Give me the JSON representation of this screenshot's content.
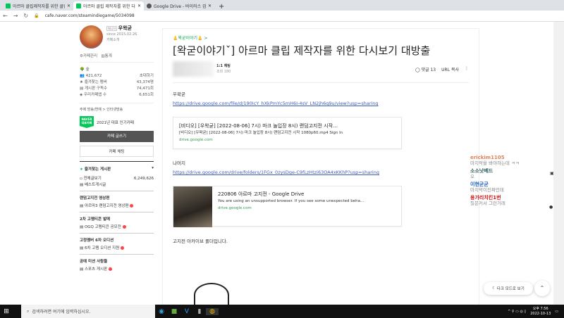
{
  "browser": {
    "tabs": [
      {
        "title": "아르마 클립제작자를 위한 클립영상",
        "active": false
      },
      {
        "title": "아르마 클립 제작자를 위한 다시",
        "active": true
      },
      {
        "title": "Google Drive - 바이러스 검사",
        "active": false
      }
    ],
    "url": "cafe.naver.com/steamindiegame/5034098"
  },
  "sidebar": {
    "manager_tag": "매니저",
    "manager": "우왁굳",
    "since": "since 2015.02.26.",
    "cafe_intro": "카페소개",
    "manage": "카페관리",
    "stats_link": "통계",
    "level": "숲",
    "members": "421,672",
    "invite": "초대하기",
    "stats": [
      {
        "label": "즐겨찾는 멤버",
        "value": "43,374명"
      },
      {
        "label": "게시판 구독수",
        "value": "74,471회"
      },
      {
        "label": "우리카페앱 수",
        "value": "6,651회"
      }
    ],
    "topic": "주제  방송/연예 > 인터넷방송",
    "naver_badge": "NAVER 대표카페",
    "award": "2021년 대표 인기카페",
    "write_btn": "카페 글쓰기",
    "chat_btn": "카페 채팅",
    "fav_header": "즐겨찾는 게시판",
    "boards": [
      {
        "label": "전체글보기",
        "count": "6,249,626"
      },
      {
        "label": "베스트게시글"
      }
    ],
    "groups": [
      {
        "title": "랜덤고지전 영상편",
        "items": [
          "아르마3 랜덤고지전 영상편"
        ]
      },
      {
        "title": "2차 고멤티콘 발매",
        "items": [
          "OGQ 고멤티콘 공모전"
        ]
      },
      {
        "title": "고정멤버 6차 오디션",
        "items": [
          "6차 고멤 오디션 지원"
        ]
      },
      {
        "title": "공예 미션 사람들",
        "items": [
          "스포츠 게시판"
        ]
      }
    ]
  },
  "article": {
    "category": "👃왁굳이야기👃 >",
    "title": "[왁굳이야기ˇ] 아르마 클립 제작자를 위한 다시보기 대방출",
    "author_tag": "1:1 채팅",
    "views": "조회 180",
    "comments": "댓글 13",
    "copy_url": "URL 복사",
    "p1": "우왁굳",
    "link1": "https://drive.google.com/file/d/190IcY_hXkPmYc5mH6I-4sV_LN2jh6q9u/view?usp=sharing",
    "card1": {
      "title": "[비디오] [우왁굳] [2022-08-06] 7시) 마크 놀입장 8시) 랜덤고지전 시작…",
      "desc": "[비디오] [우왁굳] [2022-08-06] 7시) 마크 놀입장 8시) 랜덤고지전 시작 1080p60.mp4 Sign In",
      "domain": "drive.google.com"
    },
    "p2": "나머지",
    "link2": "https://drive.google.com/drive/folders/1FGx_0zysDge-C9fLzHtzi63OA4xKKhP?usp=sharing",
    "card2": {
      "title": "220806 아르마 고지전 - Google Drive",
      "desc": "You are using an unsupported browser. If you see some unexpected beha...",
      "domain": "drive.google.com"
    },
    "p3": "고지전 아카이브 폴더입니다."
  },
  "chat": [
    {
      "name": "erickim1105",
      "msg": "마지막을 봐야하는데 ㅋㅋ",
      "color": "#e0825a"
    },
    {
      "name": "소소낫베드",
      "msg": "오",
      "color": "#2a5a5a"
    },
    {
      "name": "이현균균",
      "msg": "마지막이진짜인데",
      "color": "#1a5fc0"
    },
    {
      "name": "용가리치킨1번",
      "msg": "질문커서 그런거래",
      "color": "#d01010"
    }
  ],
  "dark_mode": "다크 모드로 보기",
  "top_btn": "⌃",
  "taskbar": {
    "search": "검색하려면 여기에 입력하십시오.",
    "time": "오후 7:56",
    "date": "2022-10-13"
  }
}
